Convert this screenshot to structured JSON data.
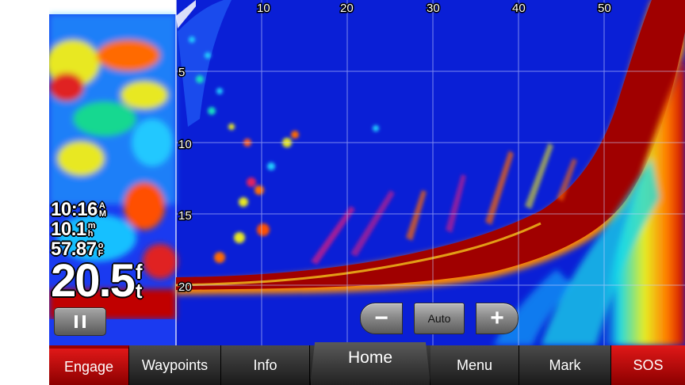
{
  "sonar": {
    "range_labels": [
      "10",
      "20",
      "30",
      "40",
      "50"
    ],
    "depth_labels": [
      "5",
      "10",
      "15",
      "20"
    ]
  },
  "readouts": {
    "time_value": "10:16",
    "time_unit_top": "A",
    "time_unit_bottom": "M",
    "speed_value": "10.1",
    "speed_unit_top": "m",
    "speed_unit_bottom": "h",
    "temp_value": "57.87",
    "temp_unit_top": "o",
    "temp_unit_bottom": "F",
    "depth_value": "20.5",
    "depth_unit_top": "f",
    "depth_unit_bottom": "t"
  },
  "controls": {
    "pause_icon": "pause-icon",
    "zoom_out_label": "−",
    "zoom_auto_label": "Auto",
    "zoom_in_label": "+"
  },
  "nav": {
    "engage": "Engage",
    "waypoints": "Waypoints",
    "info": "Info",
    "home": "Home",
    "menu": "Menu",
    "mark": "Mark",
    "sos": "SOS"
  },
  "colors": {
    "background_blue": "#0a1fd6",
    "return_red": "#a00000",
    "alert_red": "#d00000"
  }
}
